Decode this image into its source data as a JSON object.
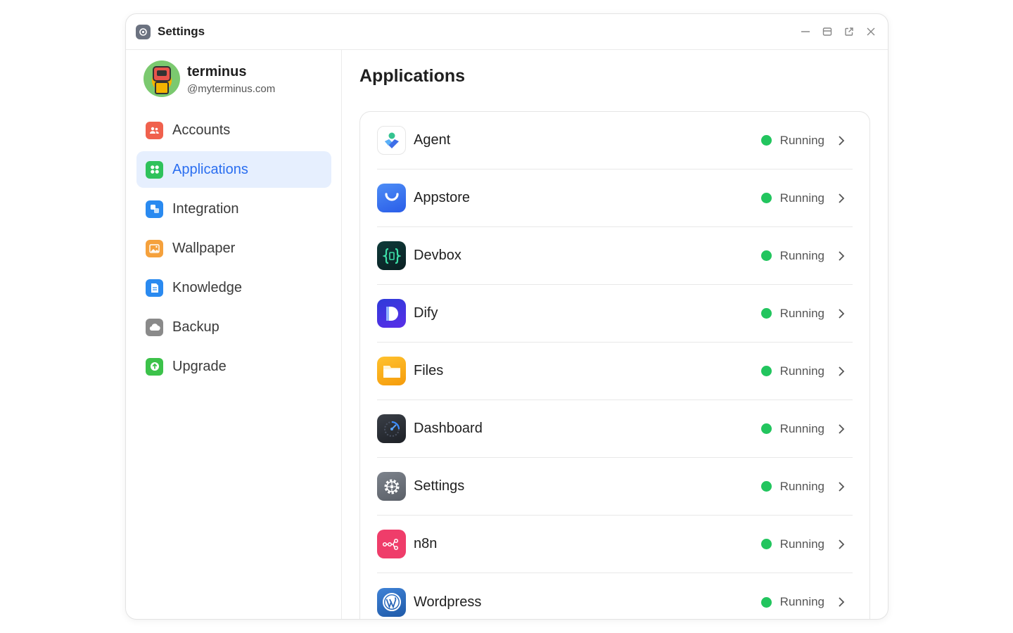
{
  "window": {
    "title": "Settings"
  },
  "profile": {
    "name": "terminus",
    "domain": "@myterminus.com"
  },
  "sidebar": {
    "items": [
      {
        "label": "Accounts",
        "icon": "users-icon",
        "color": "#f0614d",
        "active": false
      },
      {
        "label": "Applications",
        "icon": "apps-grid-icon",
        "color": "#2fc25b",
        "active": true
      },
      {
        "label": "Integration",
        "icon": "integration-icon",
        "color": "#2a8af0",
        "active": false
      },
      {
        "label": "Wallpaper",
        "icon": "image-icon",
        "color": "#f5a13c",
        "active": false
      },
      {
        "label": "Knowledge",
        "icon": "document-icon",
        "color": "#2a8af0",
        "active": false
      },
      {
        "label": "Backup",
        "icon": "cloud-icon",
        "color": "#8a8a8a",
        "active": false
      },
      {
        "label": "Upgrade",
        "icon": "upgrade-arrow-icon",
        "color": "#3cc24a",
        "active": false
      }
    ]
  },
  "main": {
    "title": "Applications",
    "apps": [
      {
        "name": "Agent",
        "status": "Running",
        "icon": "agent-icon"
      },
      {
        "name": "Appstore",
        "status": "Running",
        "icon": "appstore-bag-icon"
      },
      {
        "name": "Devbox",
        "status": "Running",
        "icon": "devbox-braces-icon"
      },
      {
        "name": "Dify",
        "status": "Running",
        "icon": "dify-icon"
      },
      {
        "name": "Files",
        "status": "Running",
        "icon": "folder-icon"
      },
      {
        "name": "Dashboard",
        "status": "Running",
        "icon": "speedometer-icon"
      },
      {
        "name": "Settings",
        "status": "Running",
        "icon": "gear-icon"
      },
      {
        "name": "n8n",
        "status": "Running",
        "icon": "n8n-workflow-icon"
      },
      {
        "name": "Wordpress",
        "status": "Running",
        "icon": "wordpress-icon"
      }
    ]
  },
  "colors": {
    "accent": "#2a6ef0",
    "running": "#22c55e",
    "active_bg": "#e6effe"
  }
}
